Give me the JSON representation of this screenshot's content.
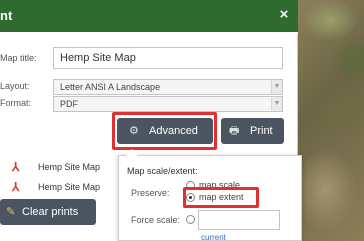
{
  "panel": {
    "title": "nt",
    "close_glyph": "×"
  },
  "form": {
    "map_title_label": "Map title:",
    "map_title_value": "Hemp Site Map",
    "layout_label": "Layout:",
    "layout_value": "Letter ANSI A Landscape",
    "format_label": "Format:",
    "format_value": "PDF"
  },
  "buttons": {
    "advanced_label": "Advanced",
    "advanced_icon": "gear-icon",
    "print_label": "Print",
    "print_icon": "printer-icon",
    "clear_label": "Clear prints",
    "clear_icon": "broom-icon"
  },
  "print_results": [
    {
      "name": "Hemp Site Map",
      "icon": "pdf-icon"
    },
    {
      "name": "Hemp Site Map",
      "icon": "pdf-icon"
    }
  ],
  "advanced": {
    "title": "Map scale/extent:",
    "preserve_label": "Preserve:",
    "option_scale": "map scale",
    "option_extent": "map extent",
    "selected": "map extent",
    "force_scale_label": "Force scale:",
    "force_scale_value": "",
    "current_link": "current"
  },
  "colors": {
    "header_bg": "#2f6a2e",
    "button_bg": "#4b5561",
    "highlight": "#e03030",
    "link": "#3366cc",
    "pdf": "#d7372b"
  }
}
